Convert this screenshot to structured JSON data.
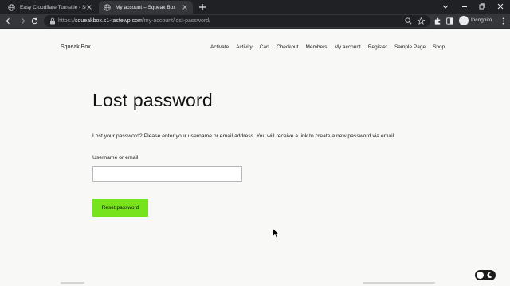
{
  "browser": {
    "tabs": [
      {
        "title": "Easy Cloudflare Turnstile ‹ Squeak",
        "icon": "globe-icon",
        "active": false
      },
      {
        "title": "My account – Squeak Box",
        "icon": "globe-icon",
        "active": true
      }
    ],
    "url_scheme": "https://",
    "url_host": "squeakbox.s1-tastewp.com",
    "url_path": "/my-account/lost-password/",
    "profile_label": "Incognito"
  },
  "site": {
    "title": "Squeak Box",
    "nav": [
      "Activate",
      "Activity",
      "Cart",
      "Checkout",
      "Members",
      "My account",
      "Register",
      "Sample Page",
      "Shop"
    ]
  },
  "form": {
    "heading": "Lost password",
    "intro": "Lost your password? Please enter your username or email address. You will receive a link to create a new password via email.",
    "field_label": "Username or email",
    "field_value": "",
    "submit_label": "Reset password"
  },
  "colors": {
    "accent": "#77e31d",
    "page_bg": "#f8f8f6",
    "chrome_bg": "#202124",
    "toolbar_bg": "#35363a"
  }
}
